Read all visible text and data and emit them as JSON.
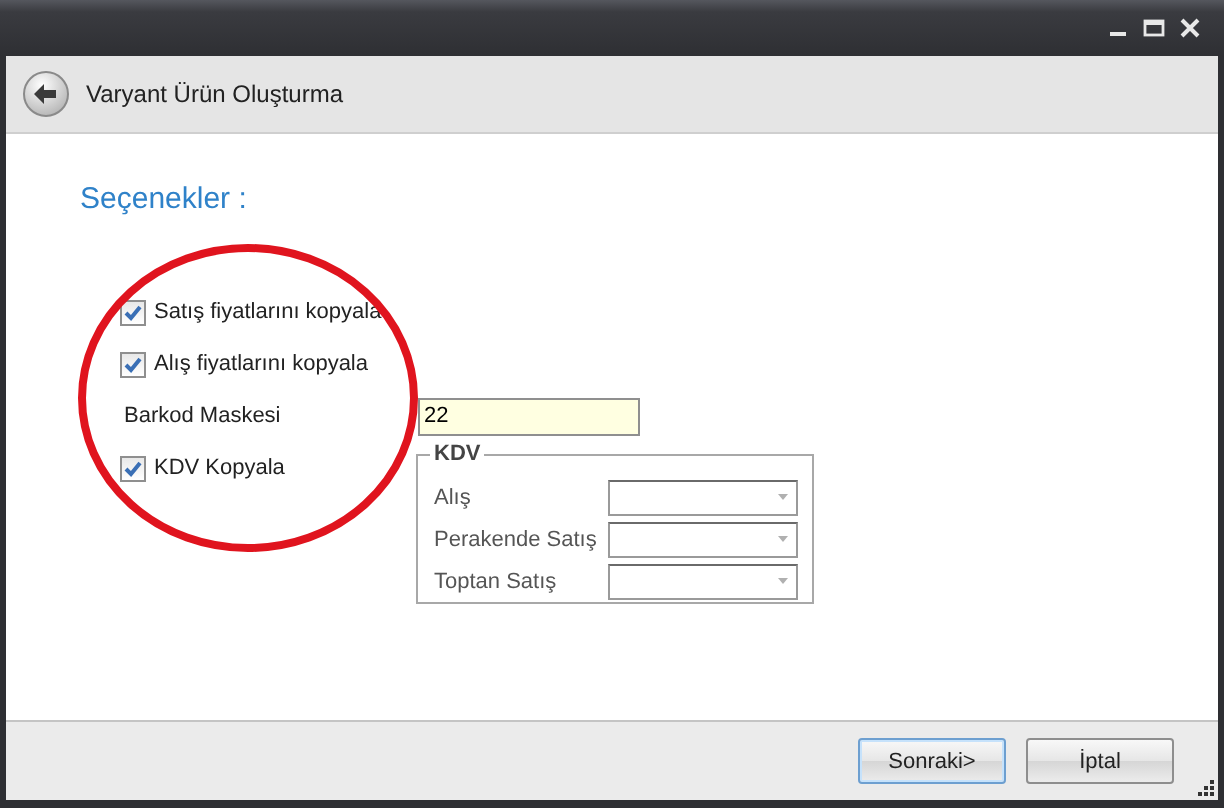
{
  "header": {
    "title": "Varyant Ürün Oluşturma"
  },
  "section_title": "Seçenekler :",
  "options": [
    {
      "kind": "checkbox",
      "label": "Satış fiyatlarını kopyala",
      "checked": true
    },
    {
      "kind": "checkbox",
      "label": "Alış fiyatlarını kopyala",
      "checked": true
    },
    {
      "kind": "field",
      "label": "Barkod Maskesi",
      "value": "22"
    },
    {
      "kind": "checkbox",
      "label": "KDV Kopyala",
      "checked": true
    }
  ],
  "kdv_group": {
    "title": "KDV",
    "rows": [
      {
        "label": "Alış"
      },
      {
        "label": "Perakende Satış"
      },
      {
        "label": "Toptan Satış"
      }
    ]
  },
  "buttons": [
    {
      "label": "Sonraki>",
      "default": true
    },
    {
      "label": "İptal",
      "default": false
    }
  ]
}
